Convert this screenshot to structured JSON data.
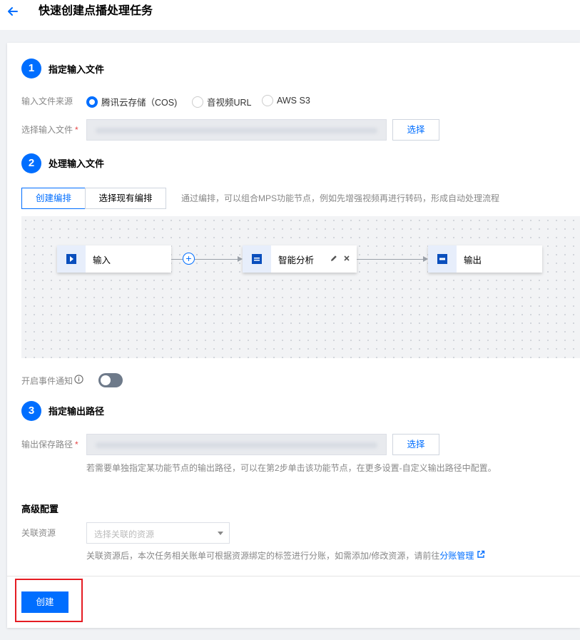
{
  "header": {
    "title": "快速创建点播处理任务"
  },
  "step1": {
    "number": "1",
    "title": "指定输入文件",
    "source_label": "输入文件来源",
    "sources": [
      {
        "label": "腾讯云存储（COS)",
        "checked": true
      },
      {
        "label": "音视频URL",
        "checked": false
      },
      {
        "label": "AWS S3",
        "checked": false
      }
    ],
    "file_label": "选择输入文件",
    "required_mark": "*",
    "select_button": "选择"
  },
  "step2": {
    "number": "2",
    "title": "处理输入文件",
    "tabs": [
      {
        "label": "创建编排",
        "active": true
      },
      {
        "label": "选择现有编排",
        "active": false
      }
    ],
    "hint": "通过编排，可以组合MPS功能节点，例如先增强视频再进行转码，形成自动处理流程",
    "nodes": [
      {
        "label": "输入",
        "icon": "play-icon"
      },
      {
        "label": "智能分析",
        "icon": "analysis-icon"
      },
      {
        "label": "输出",
        "icon": "output-icon"
      }
    ],
    "add_symbol": "+",
    "event_label": "开启事件通知",
    "event_enabled": false
  },
  "step3": {
    "number": "3",
    "title": "指定输出路径",
    "path_label": "输出保存路径",
    "required_mark": "*",
    "select_button": "选择",
    "hint": "若需要单独指定某功能节点的输出路径，可以在第2步单击该功能节点，在更多设置-自定义输出路径中配置。"
  },
  "advanced": {
    "title": "高级配置",
    "resource_label": "关联资源",
    "resource_placeholder": "选择关联的资源",
    "hint_prefix": "关联资源后，本次任务相关账单可根据资源绑定的标签进行分账，如需添加/修改资源，请前往",
    "hint_link": "分账管理"
  },
  "footer": {
    "create_button": "创建"
  },
  "colors": {
    "accent": "#006eff",
    "highlight": "#e51c23"
  }
}
